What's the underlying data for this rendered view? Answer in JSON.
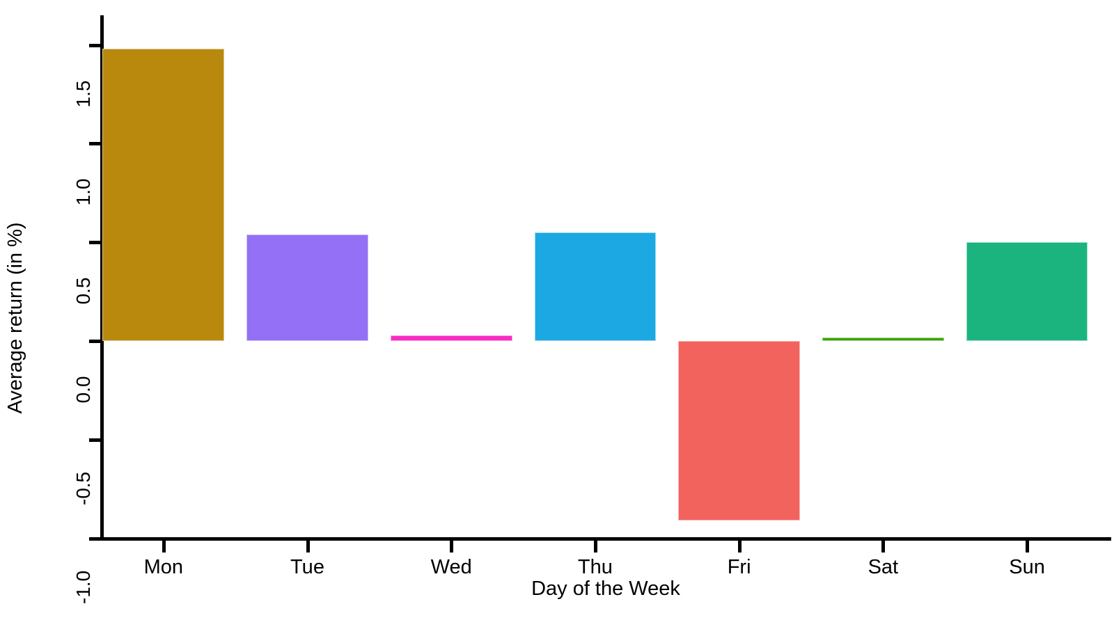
{
  "chart_data": {
    "type": "bar",
    "title": "",
    "subtitle": "",
    "xlabel": "Day of the Week",
    "ylabel": "Average return (in %)",
    "categories": [
      "Mon",
      "Tue",
      "Wed",
      "Thu",
      "Fri",
      "Sat",
      "Sun"
    ],
    "values": [
      1.48,
      0.54,
      0.03,
      0.55,
      -0.91,
      0.02,
      0.5
    ],
    "colors": [
      "#B8890C",
      "#9370F5",
      "#F72CC4",
      "#1CA8E3",
      "#F2635E",
      "#3DA309",
      "#1BB47E"
    ],
    "ylim": [
      -1.0,
      1.65
    ],
    "yticks": [
      "1.5",
      "1.0",
      "0.5",
      "0.0",
      "-0.5",
      "-1.0"
    ],
    "ytick_values": [
      1.5,
      1.0,
      0.5,
      0.0,
      -0.5,
      -1.0
    ],
    "grid": false,
    "legend": "none",
    "series": [
      {
        "name": "Average return (in %)",
        "values": [
          1.48,
          0.54,
          0.03,
          0.55,
          -0.91,
          0.02,
          0.5
        ]
      }
    ]
  },
  "axes": {
    "y_title": "Average return (in %)",
    "x_title": "Day of the Week"
  }
}
